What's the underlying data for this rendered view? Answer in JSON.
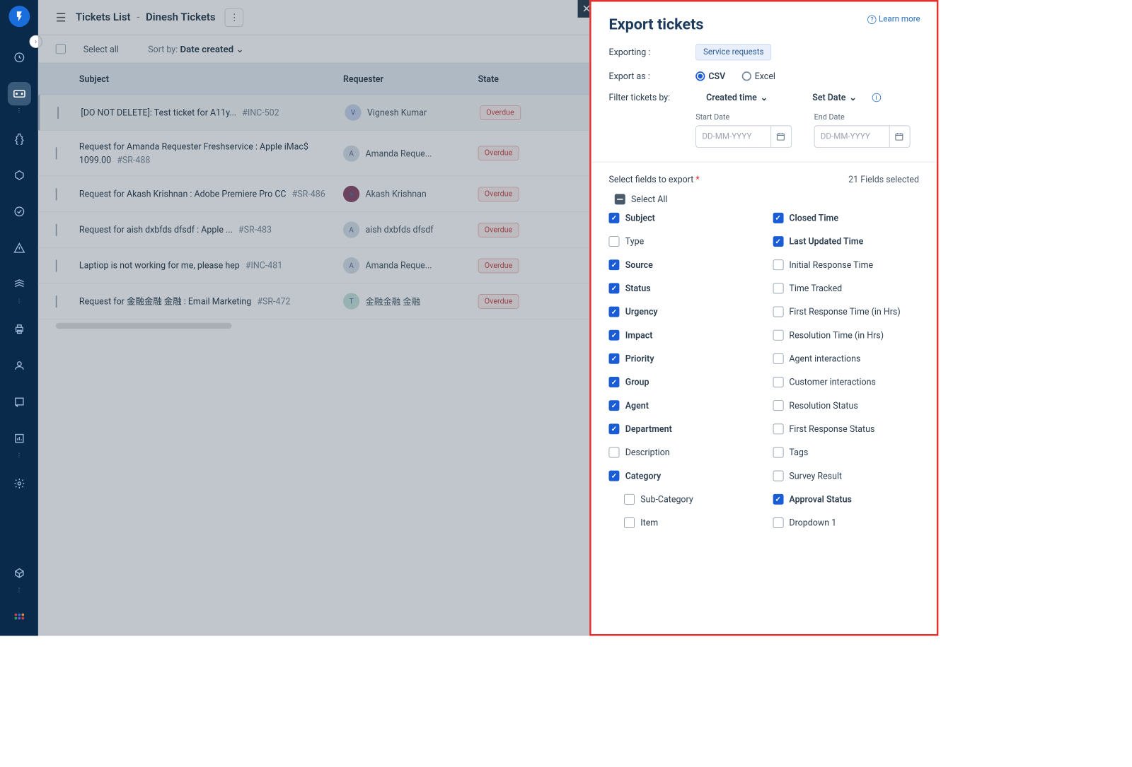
{
  "header": {
    "title_prefix": "Tickets List",
    "title_separator": "-",
    "title_view": "Dinesh Tickets"
  },
  "toolbar": {
    "select_all_label": "Select all",
    "sort_prefix": "Sort by:",
    "sort_value": "Date created"
  },
  "columns": {
    "subject": "Subject",
    "requester": "Requester",
    "state": "State"
  },
  "rows": [
    {
      "subject": "[DO NOT DELETE]: Test ticket for A11y...",
      "ticket_id": "#INC-502",
      "avatar_initial": "V",
      "avatar_color": "#c8d4ec",
      "requester": "Vignesh Kumar",
      "state": "Overdue"
    },
    {
      "subject": "Request for Amanda Requester Freshservice : Apple iMac$ 1099.00",
      "ticket_id": "#SR-488",
      "avatar_initial": "A",
      "avatar_color": "#d8e0ea",
      "requester": "Amanda Reque...",
      "state": "Overdue"
    },
    {
      "subject": "Request for Akash Krishnan : Adobe Premiere Pro CC",
      "ticket_id": "#SR-486",
      "avatar_initial": "●",
      "avatar_color": "#8a4a6a",
      "requester": "Akash Krishnan",
      "state": "Overdue"
    },
    {
      "subject": "Request for aish dxbfds dfsdf : Apple ...",
      "ticket_id": "#SR-483",
      "avatar_initial": "A",
      "avatar_color": "#d8e0ea",
      "requester": "aish dxbfds dfsdf",
      "state": "Overdue"
    },
    {
      "subject": "Laptiop is not working for me, please hep",
      "ticket_id": "#INC-481",
      "avatar_initial": "A",
      "avatar_color": "#d8e0ea",
      "requester": "Amanda Reque...",
      "state": "Overdue"
    },
    {
      "subject": "Request for 金融金融 金融 : Email Marketing",
      "ticket_id": "#SR-472",
      "avatar_initial": "T",
      "avatar_color": "#c8e4e0",
      "requester": "金融金融 金融",
      "state": "Overdue"
    }
  ],
  "panel": {
    "title": "Export tickets",
    "learn_more": "Learn more",
    "exporting_label": "Exporting :",
    "exporting_tag": "Service requests",
    "export_as_label": "Export as :",
    "format_csv": "CSV",
    "format_excel": "Excel",
    "filter_label": "Filter tickets by:",
    "filter_by": "Created time",
    "set_date": "Set Date",
    "start_date_label": "Start Date",
    "end_date_label": "End Date",
    "date_placeholder": "DD-MM-YYYY",
    "select_fields_label": "Select fields to export",
    "fields_selected": "21 Fields selected",
    "select_all": "Select All"
  },
  "left_fields": [
    {
      "label": "Subject",
      "checked": true
    },
    {
      "label": "Type",
      "checked": false
    },
    {
      "label": "Source",
      "checked": true
    },
    {
      "label": "Status",
      "checked": true
    },
    {
      "label": "Urgency",
      "checked": true
    },
    {
      "label": "Impact",
      "checked": true
    },
    {
      "label": "Priority",
      "checked": true
    },
    {
      "label": "Group",
      "checked": true
    },
    {
      "label": "Agent",
      "checked": true
    },
    {
      "label": "Department",
      "checked": true
    },
    {
      "label": "Description",
      "checked": false
    },
    {
      "label": "Category",
      "checked": true
    },
    {
      "label": "Sub-Category",
      "checked": false,
      "indent": true
    },
    {
      "label": "Item",
      "checked": false,
      "indent": true
    }
  ],
  "right_fields": [
    {
      "label": "Closed Time",
      "checked": true
    },
    {
      "label": "Last Updated Time",
      "checked": true
    },
    {
      "label": "Initial Response Time",
      "checked": false
    },
    {
      "label": "Time Tracked",
      "checked": false
    },
    {
      "label": "First Response Time (in Hrs)",
      "checked": false
    },
    {
      "label": "Resolution Time (in Hrs)",
      "checked": false
    },
    {
      "label": "Agent interactions",
      "checked": false
    },
    {
      "label": "Customer interactions",
      "checked": false
    },
    {
      "label": "Resolution Status",
      "checked": false
    },
    {
      "label": "First Response Status",
      "checked": false
    },
    {
      "label": "Tags",
      "checked": false
    },
    {
      "label": "Survey Result",
      "checked": false
    },
    {
      "label": "Approval Status",
      "checked": true
    },
    {
      "label": "Dropdown 1",
      "checked": false
    }
  ]
}
